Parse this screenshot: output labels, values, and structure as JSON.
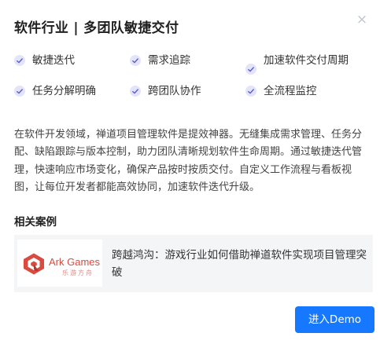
{
  "dialog": {
    "title": "软件行业 | 多团队敏捷交付",
    "close_symbol": "×"
  },
  "features": [
    [
      {
        "label": "敏捷迭代",
        "icon": "check-icon"
      },
      {
        "label": "需求追踪",
        "icon": "check-icon"
      },
      {
        "label": "加速软件交付周期",
        "icon": "check-icon"
      }
    ],
    [
      {
        "label": "任务分解明确",
        "icon": "check-icon"
      },
      {
        "label": "跨团队协作",
        "icon": "check-icon"
      },
      {
        "label": "全流程监控",
        "icon": "check-icon"
      }
    ]
  ],
  "description": "在软件开发领域，禅道项目管理软件是提效神器。无缝集成需求管理、任务分配、缺陷跟踪与版本控制，助力团队清晰规划软件生命周期。通过敏捷迭代管理，快速响应市场变化，确保产品按时按质交付。自定义工作流程与看板视图，让每位开发者都能高效协同，加速软件迭代升级。",
  "cases": {
    "heading": "相关案例",
    "items": [
      {
        "logo_name": "Ark Games",
        "logo_sub": "乐游方舟",
        "title": "跨越鸿沟：游戏行业如何借助禅道软件实现项目管理突破"
      }
    ]
  },
  "cta": {
    "label": "进入Demo",
    "color": "#1677ff"
  },
  "colors": {
    "check_bg": "#e3e4f9",
    "check_mark": "#5b5fc7",
    "logo_red": "#d94b3f"
  }
}
